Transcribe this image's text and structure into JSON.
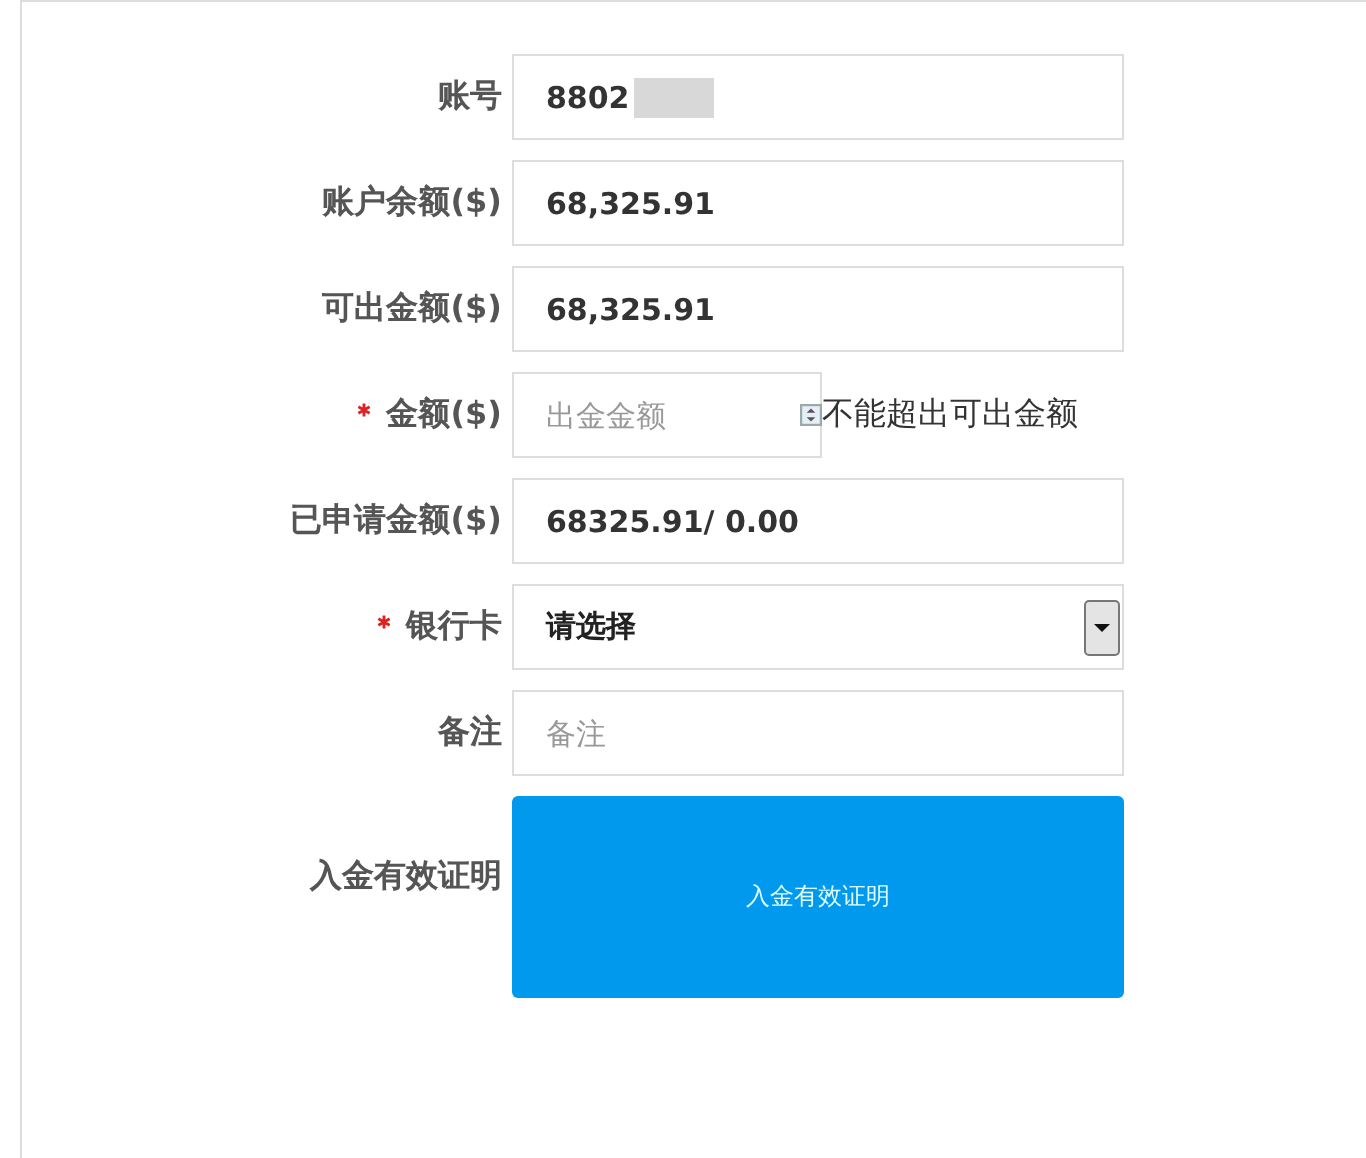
{
  "form": {
    "fields": [
      {
        "kind": "text",
        "label": "账号",
        "required": false,
        "value": "8802",
        "redacted": true
      },
      {
        "kind": "text",
        "label": "账户余额($)",
        "required": false,
        "value": "68,325.91"
      },
      {
        "kind": "text",
        "label": "可出金额($)",
        "required": false,
        "value": "68,325.91"
      },
      {
        "kind": "number",
        "label": "金额($)",
        "required": true,
        "placeholder": "出金金额",
        "hint": "不能超出可出金额"
      },
      {
        "kind": "text",
        "label": "已申请金额($)",
        "required": false,
        "value": "68325.91/ 0.00"
      },
      {
        "kind": "select",
        "label": "银行卡",
        "required": true,
        "value": "请选择"
      },
      {
        "kind": "note",
        "label": "备注",
        "required": false,
        "placeholder": "备注"
      },
      {
        "kind": "upload",
        "label": "入金有效证明",
        "required": false,
        "button": "入金有效证明"
      }
    ]
  }
}
